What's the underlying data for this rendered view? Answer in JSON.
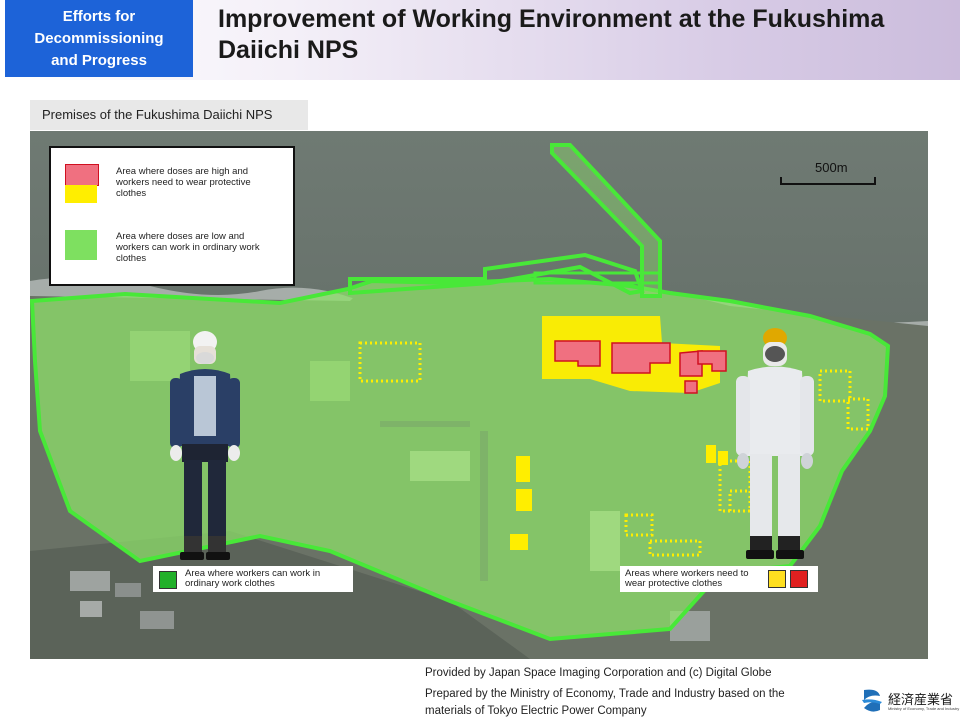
{
  "header": {
    "badge": "Efforts for Decommissioning and Progress",
    "title": "Improvement of Working Environment at the Fukushima Daiichi NPS"
  },
  "section_label": "Premises of the Fukushima Daiichi NPS",
  "legend": {
    "high_dose": "Area where doses are high and workers need to wear protective clothes",
    "low_dose": "Area where doses are low and workers can work in ordinary work clothes"
  },
  "scale_label": "500m",
  "map_labels": {
    "ordinary": "Area where workers can work in ordinary work clothes",
    "protective": "Areas where workers need to wear protective clothes"
  },
  "credits": {
    "line1": "Provided by Japan Space Imaging Corporation and (c) Digital Globe",
    "line2": "Prepared by the Ministry of Economy, Trade and Industry based on the",
    "line3": "materials of Tokyo Electric Power Company"
  },
  "logo": {
    "name": "経済産業省",
    "sub": "Ministry of Economy, Trade and Industry"
  },
  "colors": {
    "header_badge": "#1d63d8",
    "green_zone": "#8fe36a",
    "green_outline": "#48e838",
    "yellow_zone": "#ffee00",
    "red_zone": "#f07080"
  }
}
